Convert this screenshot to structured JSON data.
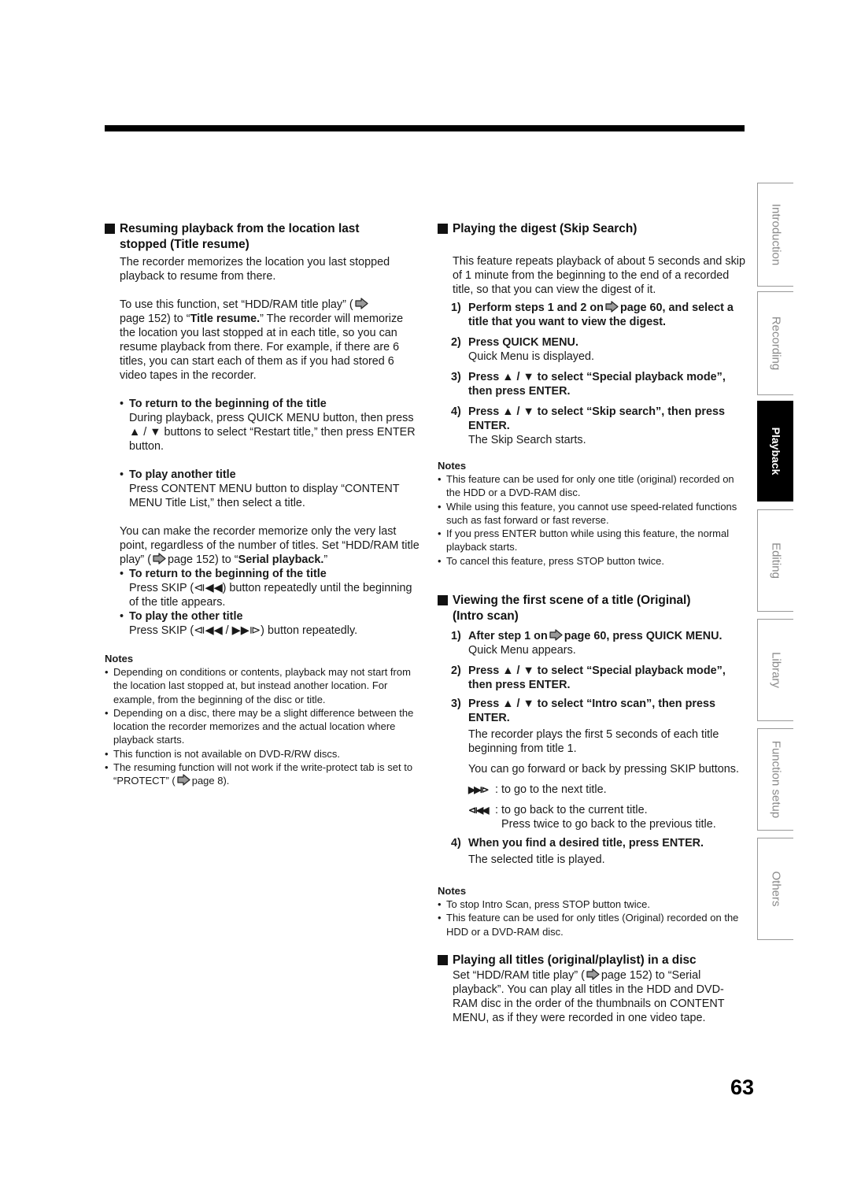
{
  "page_number": "63",
  "side_tabs": [
    {
      "label": "Introduction",
      "active": false
    },
    {
      "label": "Recording",
      "active": false
    },
    {
      "label": "Playback",
      "active": true
    },
    {
      "label": "Editing",
      "active": false
    },
    {
      "label": "Library",
      "active": false
    },
    {
      "label": "Function setup",
      "active": false
    },
    {
      "label": "Others",
      "active": false
    }
  ],
  "left": {
    "resume": {
      "heading_line1": "Resuming playback from the location last",
      "heading_line2": "stopped (Title resume)",
      "intro": "The recorder memorizes the location you last stopped playback to resume from there.",
      "para_a": "To use this function, set “HDD/RAM title play” (",
      "para_b": "page 152) to “",
      "para_bold": "Title resume.",
      "para_c": "” The recorder will memorize the location you last stopped at in each title, so you can resume playback from there. For example, if there are 6 titles, you can start each of them as if you had stored 6 video tapes in the recorder.",
      "bullets1": [
        {
          "title": "To return to the beginning of the title",
          "body": "During playback, press QUICK MENU button, then press ▲ / ▼ buttons to select “Restart title,” then press ENTER button."
        },
        {
          "title": "To play another title",
          "body": "Press CONTENT MENU button to display “CONTENT MENU Title List,” then select a title."
        }
      ],
      "serial_a": "You can make the recorder memorize only the very last point, regardless of the number of titles. Set “HDD/RAM title play” (",
      "serial_b": "page 152) to “",
      "serial_bold": "Serial playback.",
      "serial_c": "”",
      "bullets2": [
        {
          "title": "To return to the beginning of the title",
          "body": "Press SKIP (⧏◀◀) button repeatedly until the beginning of the title appears."
        },
        {
          "title": "To play the other title",
          "body": "Press SKIP (⧏◀◀ / ▶▶⧐) button repeatedly."
        }
      ]
    },
    "notes": {
      "title": "Notes",
      "items": [
        "Depending on conditions or contents, playback may not start from the location last stopped at, but instead another location. For example, from the beginning of the disc or title.",
        "Depending on a disc, there may be a slight difference between the location the recorder memorizes and the actual location where playback starts.",
        "This function is not available on DVD-R/RW discs."
      ],
      "last_a": "The resuming function will not work if the write-protect tab is set to “PROTECT” (",
      "last_b": "page 8)."
    }
  },
  "right": {
    "skip": {
      "heading": "Playing the digest (Skip Search)",
      "intro": "This feature repeats playback of about 5 seconds and skip of 1 minute from the beginning to the end of a recorded title, so that you can view the digest of it.",
      "step1_a": "Perform steps 1 and 2 on",
      "step1_b": "page 60, and select a title that you want to view the digest.",
      "steps": [
        {
          "num": "2)",
          "title": "Press QUICK MENU.",
          "body": "Quick Menu is displayed."
        },
        {
          "num": "3)",
          "title": "Press ▲ / ▼ to select “Special playback mode”, then press ENTER.",
          "body": ""
        },
        {
          "num": "4)",
          "title": "Press ▲ / ▼ to select “Skip search”, then press ENTER.",
          "body": "The Skip Search starts."
        }
      ],
      "notes_title": "Notes",
      "notes": [
        "This feature can be used for only one title (original) recorded on the HDD or a DVD-RAM disc.",
        "While using this feature, you cannot use speed-related functions such as fast forward or fast reverse.",
        "If you press ENTER button while using this feature, the normal playback starts.",
        "To cancel this feature, press STOP button twice."
      ]
    },
    "intro_scan": {
      "heading_line1": "Viewing the first scene of a title (Original)",
      "heading_line2": "(Intro scan)",
      "step1_a": "After step 1 on",
      "step1_b": "page 60, press QUICK MENU.",
      "step1_body": "Quick Menu appears.",
      "step2": "Press ▲ / ▼ to select “Special playback mode”, then press ENTER.",
      "step3": "Press ▲ / ▼ to select “Intro scan”, then press ENTER.",
      "step3_body1": "The recorder plays the first 5 seconds of each title beginning from title 1.",
      "step3_body2": "You can go forward or back by pressing SKIP buttons.",
      "skip_next_sym": "▶▶⧐",
      "skip_next": ": to go to the next title.",
      "skip_prev_sym": "⧏◀◀",
      "skip_prev": ": to go back to the current title.",
      "skip_prev2": "Press twice to go back to the previous title.",
      "step4": "When you find a desired title, press ENTER.",
      "step4_body": "The selected title is played.",
      "notes_title": "Notes",
      "notes": [
        "To stop Intro Scan, press STOP button twice.",
        "This feature can be used for only titles (Original) recorded on the HDD or a DVD-RAM disc."
      ]
    },
    "all_titles": {
      "heading": "Playing all titles (original/playlist) in a disc",
      "body_a": "Set “HDD/RAM title play” (",
      "body_b": "page 152) to “Serial playback”. You can play all titles in the HDD and DVD-RAM disc in the order of the thumbnails on CONTENT MENU, as if they were recorded in one video tape."
    }
  }
}
